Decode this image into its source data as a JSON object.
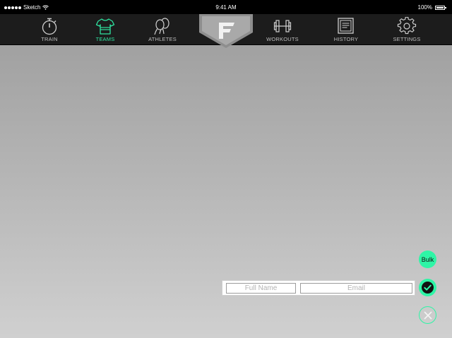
{
  "status_bar": {
    "carrier": "Sketch",
    "time": "9:41 AM",
    "battery": "100%"
  },
  "nav": {
    "items": [
      {
        "label": "TRAIN",
        "icon": "stopwatch-icon",
        "active": false
      },
      {
        "label": "TEAMS",
        "icon": "jersey-icon",
        "active": true
      },
      {
        "label": "ATHLETES",
        "icon": "people-icon",
        "active": false
      },
      {
        "label": "WORKOUTS",
        "icon": "dumbbell-icon",
        "active": false
      },
      {
        "label": "HISTORY",
        "icon": "document-icon",
        "active": false
      },
      {
        "label": "SETTINGS",
        "icon": "gear-icon",
        "active": false
      }
    ],
    "logo_letter": "F"
  },
  "actions": {
    "bulk_label": "Bulk",
    "confirm_icon": "checkmark-icon",
    "cancel_icon": "close-icon"
  },
  "add_athlete": {
    "name_placeholder": "Full Name",
    "email_placeholder": "Email",
    "name_value": "",
    "email_value": ""
  },
  "colors": {
    "accent": "#2ef5a6",
    "nav_background": "#1c1c1c",
    "nav_label": "#bdbdbd",
    "active_label": "#2fe3a0"
  }
}
